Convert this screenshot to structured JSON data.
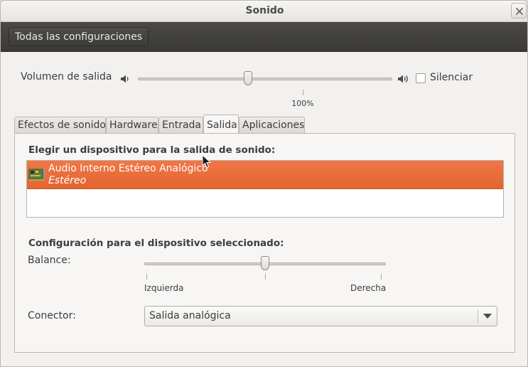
{
  "window": {
    "title": "Sonido"
  },
  "toolbar": {
    "all_settings_label": "Todas las configuraciones"
  },
  "volume": {
    "label": "Volumen de salida",
    "mark_label": "100%",
    "level_percent": 43,
    "mute_label": "Silenciar",
    "mute_checked": false
  },
  "tabs": [
    {
      "label": "Efectos de sonido",
      "active": false
    },
    {
      "label": "Hardware",
      "active": false
    },
    {
      "label": "Entrada",
      "active": false
    },
    {
      "label": "Salida",
      "active": true
    },
    {
      "label": "Aplicaciones",
      "active": false
    }
  ],
  "output": {
    "choose_device_title": "Elegir un dispositivo para la salida de sonido:",
    "devices": [
      {
        "name": "Audio Interno Estéreo Analógico",
        "profile": "Estéreo",
        "selected": true
      }
    ],
    "selected_device_title": "Configuración para el dispositivo seleccionado:",
    "balance_label": "Balance:",
    "balance_left_label": "Izquierda",
    "balance_right_label": "Derecha",
    "balance_value": 0.5,
    "connector_label": "Conector:",
    "connector_value": "Salida analógica"
  },
  "colors": {
    "selection": "#e9692f",
    "toolbar": "#3e3d39",
    "window_bg": "#f2f1f0"
  },
  "icons": {
    "close": "close-icon",
    "volume_low": "speaker-low-icon",
    "volume_high": "speaker-high-icon",
    "device": "sound-card-icon",
    "dropdown": "chevron-down-icon"
  }
}
